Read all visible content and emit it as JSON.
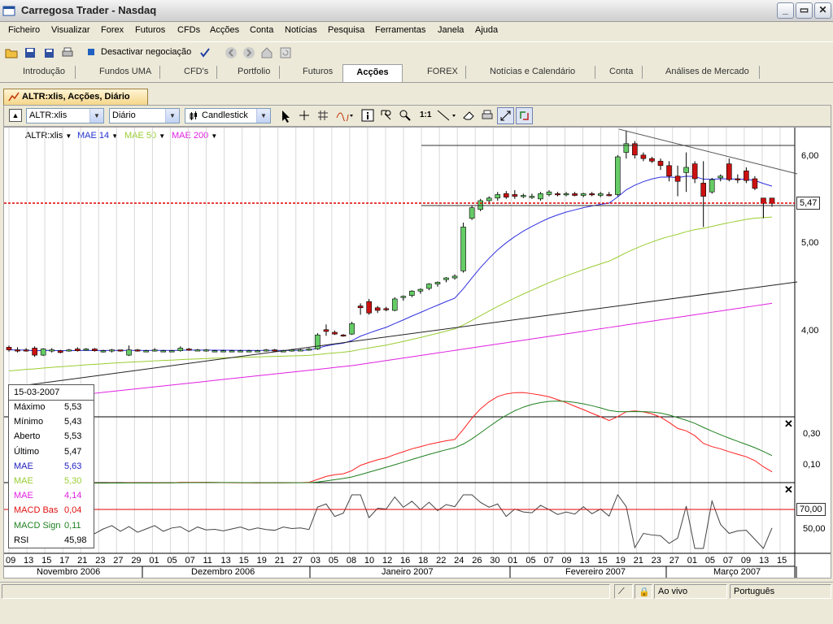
{
  "window": {
    "title": "Carregosa Trader - Nasdaq"
  },
  "menu": [
    "Ficheiro",
    "Visualizar",
    "Forex",
    "Futuros",
    "CFDs",
    "Acções",
    "Conta",
    "Notícias",
    "Pesquisa",
    "Ferramentas",
    "Janela",
    "Ajuda"
  ],
  "toolbar": {
    "deactivate_label": "Desactivar negociação"
  },
  "tabs": [
    "Introdução",
    "Fundos UMA",
    "CFD's",
    "Portfolio",
    "Futuros",
    "Acções",
    "FOREX",
    "Notícias e Calendário",
    "Conta",
    "Análises de Mercado"
  ],
  "active_tab": "Acções",
  "doc_tab": "ALTR:xlis, Acções, Diário",
  "chart_toolbar": {
    "symbol": "ALTR:xlis",
    "period": "Diário",
    "chart_type": "Candlestick",
    "ratio_label": "1:1"
  },
  "legend": {
    "symbol": "ALTR:xlis",
    "mae14": "MAE 14",
    "mae50": "MAE 50",
    "mae200": "MAE 200"
  },
  "colors": {
    "mae14": "#3030e0",
    "mae50": "#9acd32",
    "mae200": "#e020e0",
    "bull": "#66cc66",
    "bear": "#cc1111",
    "macd_bas": "#ff2020",
    "macd_sign": "#208020"
  },
  "price_axis": {
    "labels": [
      "6,00",
      "5,47",
      "5,00",
      "4,00"
    ],
    "current": "5,47"
  },
  "macd_axis": {
    "labels": [
      "0,30",
      "0,10"
    ]
  },
  "rsi_axis": {
    "labels": [
      "70,00",
      "50,00"
    ]
  },
  "info": {
    "date": "15-03-2007",
    "rows": [
      {
        "label": "Máximo",
        "value": "5,53",
        "color": "#000000"
      },
      {
        "label": "Mínimo",
        "value": "5,43",
        "color": "#000000"
      },
      {
        "label": "Aberto",
        "value": "5,53",
        "color": "#000000"
      },
      {
        "label": "Último",
        "value": "5,47",
        "color": "#000000"
      },
      {
        "label": "MAE",
        "value": "5,63",
        "color": "#2020c0"
      },
      {
        "label": "MAE",
        "value": "5,30",
        "color": "#9acd32"
      },
      {
        "label": "MAE",
        "value": "4,14",
        "color": "#e020e0"
      },
      {
        "label": "MACD Bas",
        "value": "0,04",
        "color": "#e01010"
      },
      {
        "label": "MACD Sign",
        "value": "0,11",
        "color": "#208020"
      },
      {
        "label": "RSI",
        "value": "45,98",
        "color": "#000000"
      }
    ]
  },
  "x_days": [
    "09",
    "13",
    "15",
    "17",
    "21",
    "23",
    "27",
    "29",
    "01",
    "05",
    "07",
    "11",
    "13",
    "15",
    "19",
    "21",
    "27",
    "03",
    "05",
    "08",
    "10",
    "12",
    "16",
    "18",
    "22",
    "24",
    "26",
    "30",
    "01",
    "05",
    "07",
    "09",
    "13",
    "15",
    "19",
    "21",
    "23",
    "27",
    "01",
    "05",
    "07",
    "09",
    "13",
    "15"
  ],
  "x_months": [
    "Novembro 2006",
    "Dezembro 2006",
    "Janeiro 2007",
    "Fevereiro 2007",
    "Março 2007"
  ],
  "status": {
    "live": "Ao vivo",
    "language": "Português"
  },
  "chart_data": {
    "type": "candlestick",
    "title": "ALTR:xlis",
    "period": "Diário",
    "ylim": [
      3.5,
      6.2
    ],
    "series_ohlc": [
      {
        "o": 3.83,
        "h": 3.85,
        "l": 3.78,
        "c": 3.8
      },
      {
        "o": 3.8,
        "h": 3.83,
        "l": 3.77,
        "c": 3.79
      },
      {
        "o": 3.8,
        "h": 3.82,
        "l": 3.78,
        "c": 3.79
      },
      {
        "o": 3.82,
        "h": 3.84,
        "l": 3.72,
        "c": 3.74
      },
      {
        "o": 3.74,
        "h": 3.82,
        "l": 3.73,
        "c": 3.81
      },
      {
        "o": 3.79,
        "h": 3.82,
        "l": 3.77,
        "c": 3.8
      },
      {
        "o": 3.79,
        "h": 3.8,
        "l": 3.76,
        "c": 3.77
      },
      {
        "o": 3.79,
        "h": 3.81,
        "l": 3.78,
        "c": 3.8
      },
      {
        "o": 3.81,
        "h": 3.83,
        "l": 3.78,
        "c": 3.79
      },
      {
        "o": 3.8,
        "h": 3.82,
        "l": 3.79,
        "c": 3.81
      },
      {
        "o": 3.81,
        "h": 3.82,
        "l": 3.78,
        "c": 3.79
      },
      {
        "o": 3.79,
        "h": 3.8,
        "l": 3.77,
        "c": 3.79
      },
      {
        "o": 3.79,
        "h": 3.81,
        "l": 3.77,
        "c": 3.8
      },
      {
        "o": 3.8,
        "h": 3.8,
        "l": 3.78,
        "c": 3.79
      },
      {
        "o": 3.74,
        "h": 3.85,
        "l": 3.73,
        "c": 3.8
      },
      {
        "o": 3.8,
        "h": 3.81,
        "l": 3.78,
        "c": 3.79
      },
      {
        "o": 3.79,
        "h": 3.8,
        "l": 3.78,
        "c": 3.79
      },
      {
        "o": 3.8,
        "h": 3.82,
        "l": 3.78,
        "c": 3.8
      },
      {
        "o": 3.79,
        "h": 3.8,
        "l": 3.78,
        "c": 3.79
      },
      {
        "o": 3.79,
        "h": 3.8,
        "l": 3.78,
        "c": 3.79
      },
      {
        "o": 3.79,
        "h": 3.84,
        "l": 3.78,
        "c": 3.82
      },
      {
        "o": 3.81,
        "h": 3.82,
        "l": 3.79,
        "c": 3.8
      },
      {
        "o": 3.8,
        "h": 3.81,
        "l": 3.79,
        "c": 3.8
      },
      {
        "o": 3.8,
        "h": 3.81,
        "l": 3.78,
        "c": 3.8
      },
      {
        "o": 3.79,
        "h": 3.8,
        "l": 3.78,
        "c": 3.79
      },
      {
        "o": 3.79,
        "h": 3.8,
        "l": 3.78,
        "c": 3.79
      },
      {
        "o": 3.79,
        "h": 3.8,
        "l": 3.78,
        "c": 3.79
      },
      {
        "o": 3.79,
        "h": 3.8,
        "l": 3.78,
        "c": 3.79
      },
      {
        "o": 3.79,
        "h": 3.8,
        "l": 3.78,
        "c": 3.79
      },
      {
        "o": 3.79,
        "h": 3.8,
        "l": 3.78,
        "c": 3.79
      },
      {
        "o": 3.79,
        "h": 3.81,
        "l": 3.78,
        "c": 3.8
      },
      {
        "o": 3.8,
        "h": 3.81,
        "l": 3.78,
        "c": 3.79
      },
      {
        "o": 3.79,
        "h": 3.8,
        "l": 3.78,
        "c": 3.79
      },
      {
        "o": 3.79,
        "h": 3.81,
        "l": 3.78,
        "c": 3.8
      },
      {
        "o": 3.8,
        "h": 3.81,
        "l": 3.79,
        "c": 3.8
      },
      {
        "o": 3.8,
        "h": 3.82,
        "l": 3.79,
        "c": 3.81
      },
      {
        "o": 3.81,
        "h": 3.99,
        "l": 3.8,
        "c": 3.97
      },
      {
        "o": 4.03,
        "h": 4.09,
        "l": 3.96,
        "c": 4.01
      },
      {
        "o": 4.0,
        "h": 4.02,
        "l": 3.97,
        "c": 3.98
      },
      {
        "o": 3.97,
        "h": 3.98,
        "l": 3.95,
        "c": 3.96
      },
      {
        "o": 3.98,
        "h": 4.12,
        "l": 3.97,
        "c": 4.1
      },
      {
        "o": 4.3,
        "h": 4.33,
        "l": 4.2,
        "c": 4.28
      },
      {
        "o": 4.35,
        "h": 4.38,
        "l": 4.2,
        "c": 4.22
      },
      {
        "o": 4.28,
        "h": 4.3,
        "l": 4.22,
        "c": 4.25
      },
      {
        "o": 4.27,
        "h": 4.29,
        "l": 4.24,
        "c": 4.26
      },
      {
        "o": 4.25,
        "h": 4.4,
        "l": 4.24,
        "c": 4.38
      },
      {
        "o": 4.4,
        "h": 4.42,
        "l": 4.36,
        "c": 4.41
      },
      {
        "o": 4.42,
        "h": 4.48,
        "l": 4.4,
        "c": 4.47
      },
      {
        "o": 4.47,
        "h": 4.5,
        "l": 4.44,
        "c": 4.49
      },
      {
        "o": 4.5,
        "h": 4.56,
        "l": 4.48,
        "c": 4.55
      },
      {
        "o": 4.55,
        "h": 4.58,
        "l": 4.52,
        "c": 4.57
      },
      {
        "o": 4.6,
        "h": 4.63,
        "l": 4.57,
        "c": 4.62
      },
      {
        "o": 4.62,
        "h": 4.66,
        "l": 4.6,
        "c": 4.64
      },
      {
        "o": 4.7,
        "h": 5.25,
        "l": 4.68,
        "c": 5.2
      },
      {
        "o": 5.3,
        "h": 5.45,
        "l": 5.28,
        "c": 5.42
      },
      {
        "o": 5.4,
        "h": 5.52,
        "l": 5.38,
        "c": 5.5
      },
      {
        "o": 5.5,
        "h": 5.55,
        "l": 5.46,
        "c": 5.53
      },
      {
        "o": 5.53,
        "h": 5.6,
        "l": 5.5,
        "c": 5.57
      },
      {
        "o": 5.58,
        "h": 5.61,
        "l": 5.52,
        "c": 5.54
      },
      {
        "o": 5.57,
        "h": 5.62,
        "l": 5.52,
        "c": 5.55
      },
      {
        "o": 5.55,
        "h": 5.58,
        "l": 5.53,
        "c": 5.56
      },
      {
        "o": 5.55,
        "h": 5.58,
        "l": 5.52,
        "c": 5.55
      },
      {
        "o": 5.52,
        "h": 5.6,
        "l": 5.5,
        "c": 5.58
      },
      {
        "o": 5.57,
        "h": 5.62,
        "l": 5.55,
        "c": 5.6
      },
      {
        "o": 5.58,
        "h": 5.6,
        "l": 5.55,
        "c": 5.57
      },
      {
        "o": 5.57,
        "h": 5.6,
        "l": 5.55,
        "c": 5.58
      },
      {
        "o": 5.58,
        "h": 5.6,
        "l": 5.55,
        "c": 5.56
      },
      {
        "o": 5.56,
        "h": 5.59,
        "l": 5.54,
        "c": 5.58
      },
      {
        "o": 5.58,
        "h": 5.6,
        "l": 5.55,
        "c": 5.57
      },
      {
        "o": 5.56,
        "h": 5.6,
        "l": 5.54,
        "c": 5.58
      },
      {
        "o": 5.57,
        "h": 5.6,
        "l": 5.55,
        "c": 5.56
      },
      {
        "o": 5.57,
        "h": 6.02,
        "l": 5.55,
        "c": 6.0
      },
      {
        "o": 6.05,
        "h": 6.3,
        "l": 5.98,
        "c": 6.15
      },
      {
        "o": 6.15,
        "h": 6.18,
        "l": 5.98,
        "c": 6.02
      },
      {
        "o": 6.02,
        "h": 6.05,
        "l": 5.95,
        "c": 5.98
      },
      {
        "o": 5.98,
        "h": 6.0,
        "l": 5.93,
        "c": 5.95
      },
      {
        "o": 5.95,
        "h": 5.98,
        "l": 5.85,
        "c": 5.9
      },
      {
        "o": 5.9,
        "h": 5.95,
        "l": 5.72,
        "c": 5.78
      },
      {
        "o": 5.78,
        "h": 5.9,
        "l": 5.55,
        "c": 5.72
      },
      {
        "o": 5.82,
        "h": 6.05,
        "l": 5.6,
        "c": 5.88
      },
      {
        "o": 5.92,
        "h": 5.95,
        "l": 5.7,
        "c": 5.75
      },
      {
        "o": 5.7,
        "h": 5.95,
        "l": 5.2,
        "c": 5.55
      },
      {
        "o": 5.6,
        "h": 5.76,
        "l": 5.58,
        "c": 5.74
      },
      {
        "o": 5.76,
        "h": 5.8,
        "l": 5.72,
        "c": 5.78
      },
      {
        "o": 5.92,
        "h": 5.98,
        "l": 5.72,
        "c": 5.74
      },
      {
        "o": 5.75,
        "h": 5.8,
        "l": 5.7,
        "c": 5.74
      },
      {
        "o": 5.84,
        "h": 5.88,
        "l": 5.7,
        "c": 5.73
      },
      {
        "o": 5.75,
        "h": 5.78,
        "l": 5.62,
        "c": 5.64
      },
      {
        "o": 5.53,
        "h": 5.53,
        "l": 5.3,
        "c": 5.47
      },
      {
        "o": 5.53,
        "h": 5.53,
        "l": 5.43,
        "c": 5.47
      }
    ]
  }
}
